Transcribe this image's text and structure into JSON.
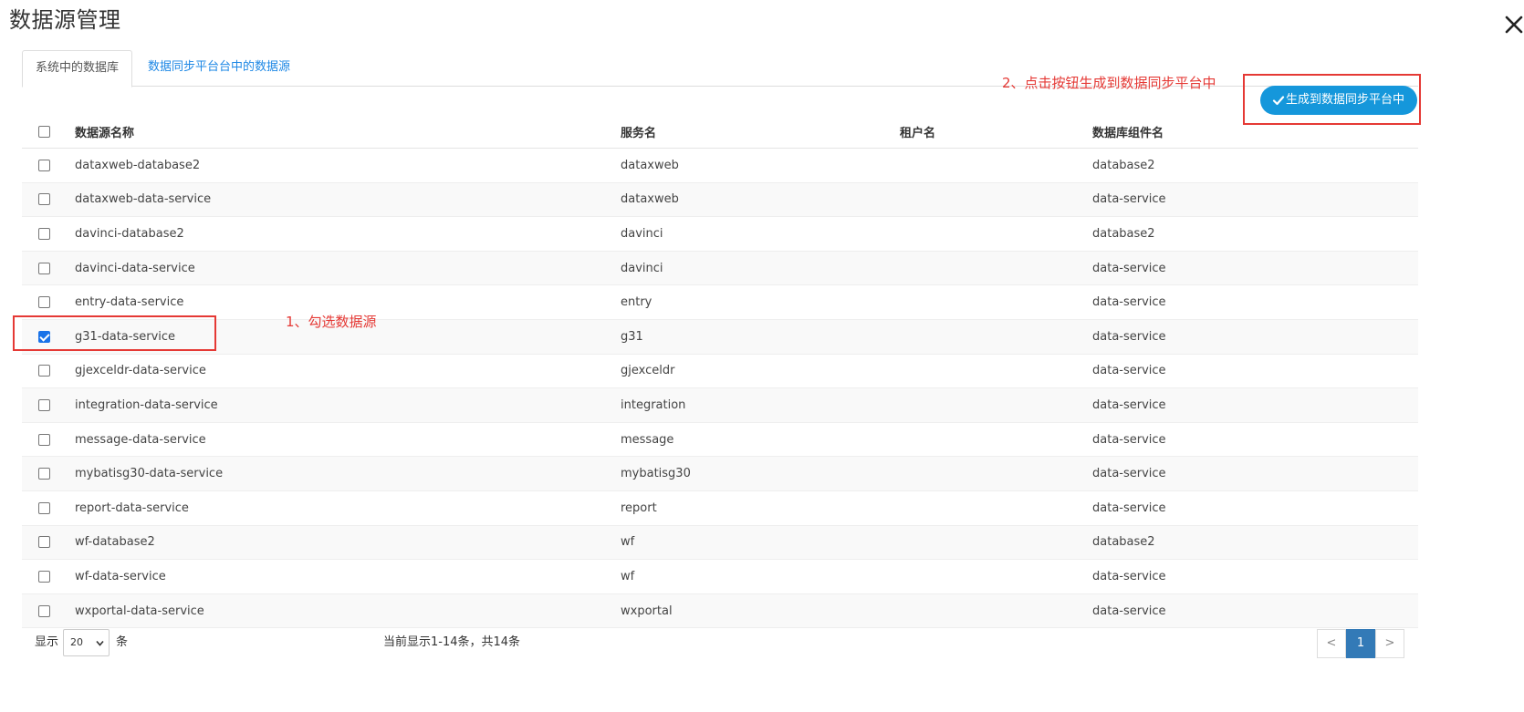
{
  "dialog": {
    "title": "数据源管理"
  },
  "tabs": [
    {
      "label": "系统中的数据库",
      "active": true
    },
    {
      "label": "数据同步平台台中的数据源",
      "active": false
    }
  ],
  "annotations": {
    "step1": "1、勾选数据源",
    "step2": "2、点击按钮生成到数据同步平台中"
  },
  "toolbar": {
    "generate_label": "生成到数据同步平台中"
  },
  "table": {
    "columns": [
      "数据源名称",
      "服务名",
      "租户名",
      "数据库组件名"
    ],
    "rows": [
      {
        "name": "dataxweb-database2",
        "service": "dataxweb",
        "tenant": "",
        "component": "database2",
        "checked": false
      },
      {
        "name": "dataxweb-data-service",
        "service": "dataxweb",
        "tenant": "",
        "component": "data-service",
        "checked": false
      },
      {
        "name": "davinci-database2",
        "service": "davinci",
        "tenant": "",
        "component": "database2",
        "checked": false
      },
      {
        "name": "davinci-data-service",
        "service": "davinci",
        "tenant": "",
        "component": "data-service",
        "checked": false
      },
      {
        "name": "entry-data-service",
        "service": "entry",
        "tenant": "",
        "component": "data-service",
        "checked": false
      },
      {
        "name": "g31-data-service",
        "service": "g31",
        "tenant": "",
        "component": "data-service",
        "checked": true
      },
      {
        "name": "gjexceldr-data-service",
        "service": "gjexceldr",
        "tenant": "",
        "component": "data-service",
        "checked": false
      },
      {
        "name": "integration-data-service",
        "service": "integration",
        "tenant": "",
        "component": "data-service",
        "checked": false
      },
      {
        "name": "message-data-service",
        "service": "message",
        "tenant": "",
        "component": "data-service",
        "checked": false
      },
      {
        "name": "mybatisg30-data-service",
        "service": "mybatisg30",
        "tenant": "",
        "component": "data-service",
        "checked": false
      },
      {
        "name": "report-data-service",
        "service": "report",
        "tenant": "",
        "component": "data-service",
        "checked": false
      },
      {
        "name": "wf-database2",
        "service": "wf",
        "tenant": "",
        "component": "database2",
        "checked": false
      },
      {
        "name": "wf-data-service",
        "service": "wf",
        "tenant": "",
        "component": "data-service",
        "checked": false
      },
      {
        "name": "wxportal-data-service",
        "service": "wxportal",
        "tenant": "",
        "component": "data-service",
        "checked": false
      }
    ]
  },
  "footer": {
    "show_label": "显示",
    "page_size": "20",
    "unit_label": "条",
    "summary": "当前显示1-14条，共14条"
  },
  "pagination": {
    "prev": "<",
    "current": "1",
    "next": ">"
  },
  "colors": {
    "accent": "#1597db",
    "annotation": "#e53935",
    "link": "#1e88e5",
    "page_active": "#337ab7"
  }
}
